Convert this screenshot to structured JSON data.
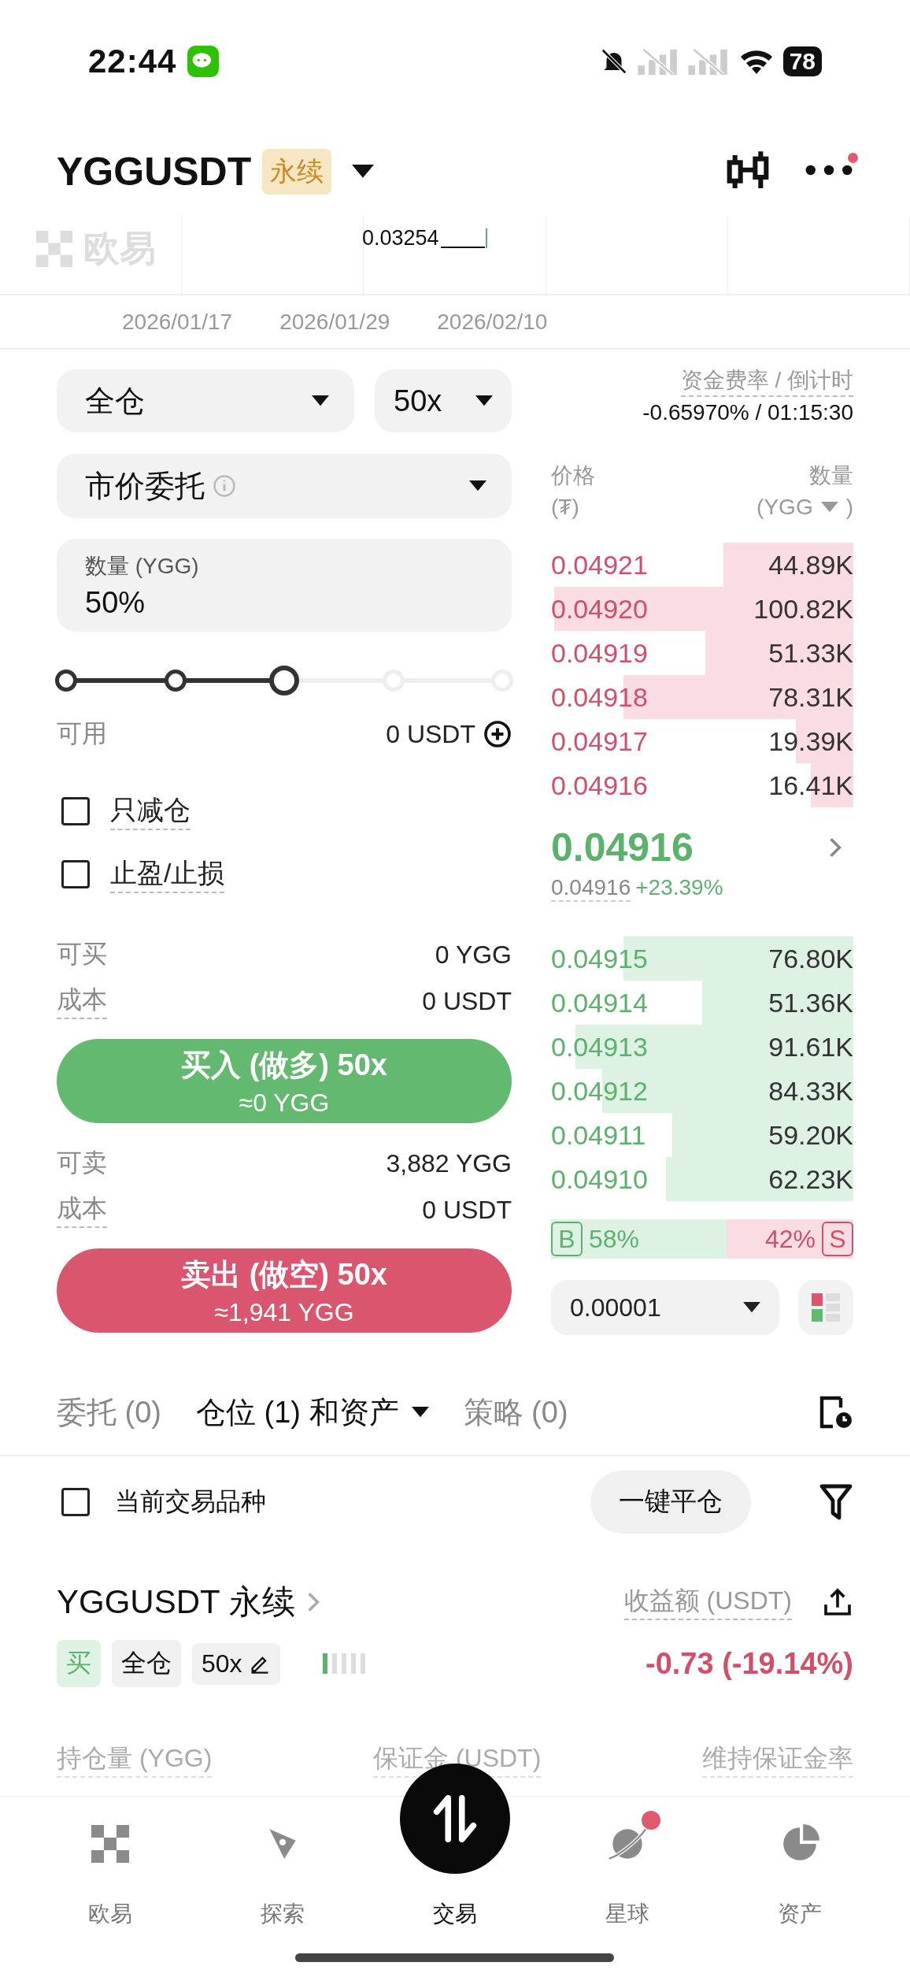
{
  "status_bar": {
    "time": "22:44",
    "battery": "78"
  },
  "header": {
    "symbol": "YGGUSDT",
    "tag": "永续",
    "notification_dot": true
  },
  "chart": {
    "logo_text": "欧易",
    "price_label": "0.03254",
    "dates": [
      "2026/01/17",
      "2026/01/29",
      "2026/02/10"
    ]
  },
  "order_form": {
    "margin_mode": "全仓",
    "leverage": "50x",
    "order_type": "市价委托",
    "quantity": {
      "label": "数量 (YGG)",
      "value": "50%"
    },
    "slider": {
      "level": 0.5
    },
    "available": {
      "label": "可用",
      "value": "0 USDT"
    },
    "options": [
      {
        "label": "只减仓",
        "checked": false
      },
      {
        "label": "止盈/止损",
        "checked": false
      }
    ],
    "buy": {
      "max_label": "可买",
      "max_value": "0 YGG",
      "cost_label": "成本",
      "cost_value": "0 USDT",
      "button": "买入 (做多) 50x",
      "button_sub": "≈0 YGG"
    },
    "sell": {
      "max_label": "可卖",
      "max_value": "3,882 YGG",
      "cost_label": "成本",
      "cost_value": "0 USDT",
      "button": "卖出 (做空) 50x",
      "button_sub": "≈1,941 YGG"
    }
  },
  "order_book": {
    "funding_label": "资金费率 / 倒计时",
    "funding_value": "-0.65970% / 01:15:30",
    "price_header": "价格",
    "price_unit": "(₮)",
    "qty_header": "数量",
    "qty_unit_open": "(YGG",
    "qty_unit_close": ")",
    "asks": [
      {
        "price": "0.04921",
        "qty": "44.89K",
        "level": 0.43
      },
      {
        "price": "0.04920",
        "qty": "100.82K",
        "level": 0.99
      },
      {
        "price": "0.04919",
        "qty": "51.33K",
        "level": 0.49
      },
      {
        "price": "0.04918",
        "qty": "78.31K",
        "level": 0.76
      },
      {
        "price": "0.04917",
        "qty": "19.39K",
        "level": 0.19
      },
      {
        "price": "0.04916",
        "qty": "16.41K",
        "level": 0.14
      }
    ],
    "last_price": "0.04916",
    "mark_price": "0.04916",
    "change": "+23.39%",
    "bids": [
      {
        "price": "0.04915",
        "qty": "76.80K",
        "level": 0.76
      },
      {
        "price": "0.04914",
        "qty": "51.36K",
        "level": 0.5
      },
      {
        "price": "0.04913",
        "qty": "91.61K",
        "level": 0.92
      },
      {
        "price": "0.04912",
        "qty": "84.33K",
        "level": 0.83
      },
      {
        "price": "0.04911",
        "qty": "59.20K",
        "level": 0.6
      },
      {
        "price": "0.04910",
        "qty": "62.23K",
        "level": 0.62
      }
    ],
    "buy_ratio": {
      "letter": "B",
      "text": "58%",
      "level": 0.58
    },
    "sell_ratio": {
      "letter": "S",
      "text": "42%"
    },
    "tick_size": "0.00001"
  },
  "position_tabs": [
    {
      "label": "委托 (0)",
      "selected": false
    },
    {
      "label": "仓位 (1) 和资产",
      "selected": true
    },
    {
      "label": "策略 (0)",
      "selected": false
    }
  ],
  "filter": {
    "label": "当前交易品种",
    "checked": false,
    "close_all": "一键平仓"
  },
  "position": {
    "title": "YGGUSDT 永续",
    "side": "买",
    "margin_mode": "全仓",
    "leverage": "50x",
    "pnl_label": "收益额 (USDT)",
    "pnl": "-0.73 (-19.14%)",
    "columns": [
      "持仓量 (YGG)",
      "保证金 (USDT)",
      "维持保证金率"
    ]
  },
  "bottom_nav": [
    {
      "label": "欧易",
      "selected": false,
      "badge": false
    },
    {
      "label": "探索",
      "selected": false,
      "badge": false
    },
    {
      "label": "交易",
      "selected": true,
      "badge": false
    },
    {
      "label": "星球",
      "selected": false,
      "badge": true
    },
    {
      "label": "资产",
      "selected": false,
      "badge": false
    }
  ]
}
